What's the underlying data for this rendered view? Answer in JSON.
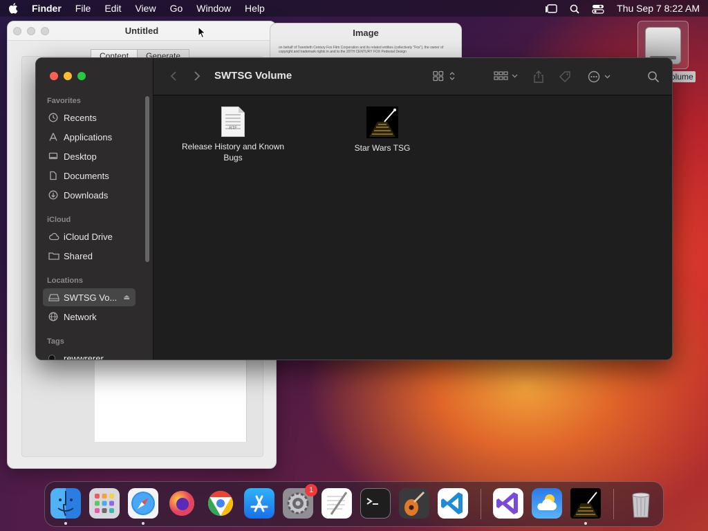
{
  "menubar": {
    "app_name": "Finder",
    "menus": [
      "File",
      "Edit",
      "View",
      "Go",
      "Window",
      "Help"
    ],
    "clock": "Thu Sep 7  8:22 AM"
  },
  "bg_windows": {
    "untitled": {
      "title": "Untitled",
      "tabs": [
        "Content",
        "Generate"
      ]
    },
    "image": {
      "title": "Image",
      "legal_text": "on behalf of Twentieth Century Fox Film Corporation and its related entities (collectively \"Fox\"), the owner of copyright and trademark rights in and to the 20TH CENTURY FOX Pedestal Design"
    }
  },
  "desktop": {
    "volume_label_visible": "olume"
  },
  "finder": {
    "title": "SWTSG Volume",
    "sidebar": {
      "favorites_header": "Favorites",
      "favorites": [
        {
          "label": "Recents",
          "icon": "clock-icon"
        },
        {
          "label": "Applications",
          "icon": "applications-icon"
        },
        {
          "label": "Desktop",
          "icon": "desktop-icon"
        },
        {
          "label": "Documents",
          "icon": "document-icon"
        },
        {
          "label": "Downloads",
          "icon": "download-icon"
        }
      ],
      "icloud_header": "iCloud",
      "icloud": [
        {
          "label": "iCloud Drive",
          "icon": "cloud-icon"
        },
        {
          "label": "Shared",
          "icon": "shared-folder-icon"
        }
      ],
      "locations_header": "Locations",
      "locations": [
        {
          "label": "SWTSG Vo...",
          "icon": "drive-icon",
          "selected": true
        },
        {
          "label": "Network",
          "icon": "globe-icon"
        }
      ],
      "tags_header": "Tags",
      "tags": [
        {
          "label": "rewwrerer"
        }
      ]
    },
    "files": [
      {
        "name": "Release History and Known Bugs",
        "kind": "rtf",
        "tag": "RTF"
      },
      {
        "name": "Star Wars TSG",
        "kind": "app"
      }
    ]
  },
  "dock": {
    "apps": [
      "Finder",
      "Launchpad",
      "Safari",
      "Firefox",
      "Chrome",
      "App Store",
      "System Settings",
      "TextEdit",
      "Terminal",
      "GarageBand",
      "Visual Studio Code",
      "Visual Studio",
      "Weather",
      "Star Wars TSG",
      "Trash"
    ],
    "settings_badge": "1"
  },
  "colors": {
    "accent_red": "#ff5f57",
    "accent_yellow": "#febc2e",
    "accent_green": "#28c840",
    "finder_bg": "#1e1e1e",
    "sidebar_bg": "#2d2b2c"
  }
}
